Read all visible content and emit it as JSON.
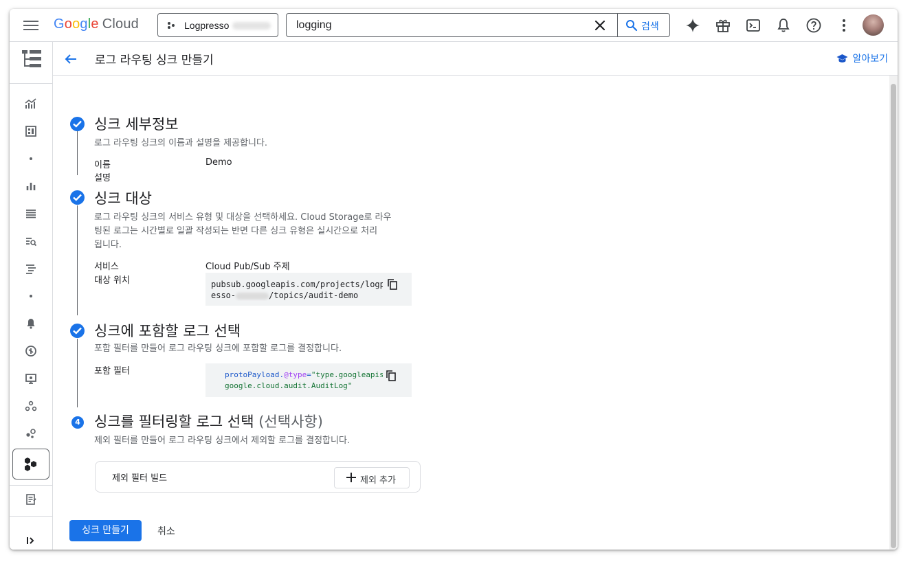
{
  "topbar": {
    "logo": {
      "g1": "G",
      "o1": "o",
      "o2": "o",
      "g2": "g",
      "l": "l",
      "e": "e",
      "cloud": "Cloud"
    },
    "project": "Logpresso",
    "search_value": "logging",
    "search_label": "검색",
    "icons": [
      "menu-icon",
      "gemini-sparkle-icon",
      "gift-icon",
      "cloud-shell-icon",
      "notifications-icon",
      "help-icon",
      "more-vert-icon"
    ]
  },
  "header": {
    "title": "로그 라우팅 싱크 만들기",
    "learn": "알아보기"
  },
  "steps": {
    "details": {
      "title": "싱크 세부정보",
      "desc": "로그 라우팅 싱크의 이름과 설명을 제공합니다.",
      "name_label": "이름",
      "name_value": "Demo",
      "description_label": "설명"
    },
    "destination": {
      "title": "싱크 대상",
      "desc_lines": [
        "로그 라우팅 싱크의 서비스 유형 및 대상을 선택하세요. Cloud Storage로 라우",
        "팅된 로그는 시간별로 일괄 작성되는 반면 다른 싱크 유형은 실시간으로 처리",
        "됩니다."
      ],
      "service_label": "서비스",
      "service_value": "Cloud Pub/Sub 주제",
      "target_label": "대상 위치",
      "target_line1": "pubsub.googleapis.com/projects/logpr",
      "target_line2_a": "esso-",
      "target_line2_b": "/topics/audit-demo"
    },
    "inclusion": {
      "title": "싱크에 포함할 로그 선택",
      "desc": "포함 필터를 만들어 로그 라우팅 싱크에 포함할 로그를 결정합니다.",
      "filter_label": "포함 필터",
      "filter_key": "protoPayload.",
      "filter_at": "@type",
      "filter_eq": "=",
      "filter_str": "\"type.googleapis.com/",
      "filter_line2": "google.cloud.audit.AuditLog\""
    },
    "exclusion": {
      "number": "4",
      "title": "싱크를 필터링할 로그 선택 ",
      "title_optional": "(선택사항)",
      "desc": "제외 필터를 만들어 로그 라우팅 싱크에서 제외할 로그를 결정합니다.",
      "build_label": "제외 필터 빌드",
      "add_label": "제외 추가"
    }
  },
  "actions": {
    "create": "싱크 만들기",
    "cancel": "취소"
  },
  "colors": {
    "accent": "#1a73e8",
    "text": "#202124",
    "secondary_text": "#5f6368",
    "border": "#dadce0",
    "code_bg": "#f1f3f4"
  }
}
